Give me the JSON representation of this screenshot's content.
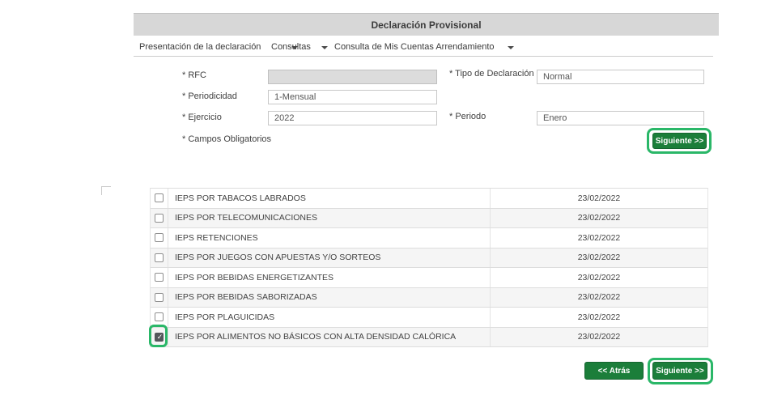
{
  "header": {
    "title": "Declaración Provisional"
  },
  "menu": {
    "items": [
      {
        "label": "Presentación de la declaración",
        "icon": "chevron-down-icon"
      },
      {
        "label": "Consultas",
        "icon": "chevron-down-icon"
      },
      {
        "label": "Consulta de Mis Cuentas Arrendamiento",
        "icon": "chevron-down-icon"
      }
    ]
  },
  "form": {
    "fields": {
      "rfc": {
        "label": "* RFC",
        "value": ""
      },
      "tipo_declaracion": {
        "label": "* Tipo de Declaración",
        "value": "Normal"
      },
      "periodicidad": {
        "label": "* Periodicidad",
        "value": "1-Mensual"
      },
      "ejercicio": {
        "label": "* Ejercicio",
        "value": "2022"
      },
      "periodo": {
        "label": "* Periodo",
        "value": "Enero"
      }
    },
    "footnote": "* Campos Obligatorios",
    "siguiente_button": "Siguiente >>"
  },
  "table": {
    "rows": [
      {
        "label": "IEPS POR TABACOS LABRADOS",
        "date": "23/02/2022",
        "checked": false
      },
      {
        "label": "IEPS POR TELECOMUNICACIONES",
        "date": "23/02/2022",
        "checked": false
      },
      {
        "label": "IEPS RETENCIONES",
        "date": "23/02/2022",
        "checked": false
      },
      {
        "label": "IEPS POR JUEGOS CON APUESTAS Y/O SORTEOS",
        "date": "23/02/2022",
        "checked": false
      },
      {
        "label": "IEPS POR BEBIDAS ENERGETIZANTES",
        "date": "23/02/2022",
        "checked": false
      },
      {
        "label": "IEPS POR BEBIDAS SABORIZADAS",
        "date": "23/02/2022",
        "checked": false
      },
      {
        "label": "IEPS POR PLAGUICIDAS",
        "date": "23/02/2022",
        "checked": false
      },
      {
        "label": "IEPS POR ALIMENTOS NO BÁSICOS CON ALTA DENSIDAD CALÓRICA",
        "date": "23/02/2022",
        "checked": true
      }
    ]
  },
  "footer": {
    "atras_button": "<< Atrás",
    "siguiente_button": "Siguiente >>"
  },
  "icons": {
    "menu_caret": "chevron-down",
    "checkbox_check": "check"
  },
  "colors": {
    "button_green": "#1b7e3a",
    "highlight_ring_green": "#2ab768",
    "titlebar_gray": "#d7d7d7",
    "checked_checkbox": "#54575b"
  }
}
